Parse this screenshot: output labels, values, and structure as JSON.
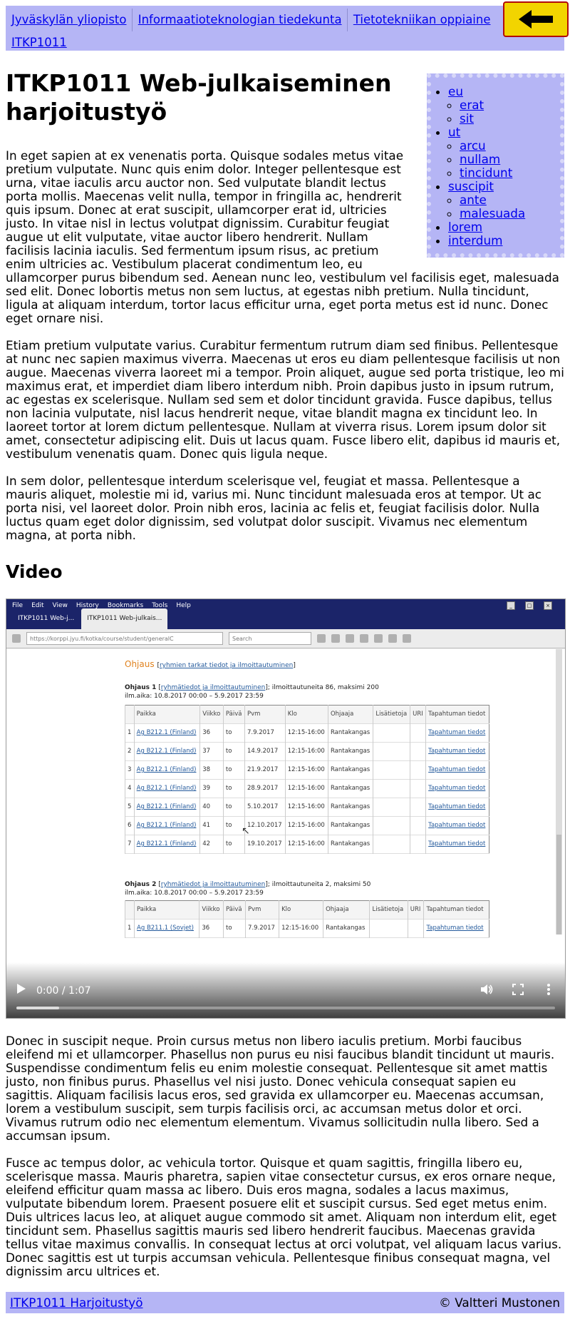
{
  "breadcrumb": [
    {
      "label": "Jyväskylän yliopisto"
    },
    {
      "label": "Informaatioteknologian tiedekunta"
    },
    {
      "label": "Tietotekniikan oppiaine"
    },
    {
      "label": "ITKP1011"
    }
  ],
  "back_button": {
    "icon": "left-arrow-icon",
    "color": "#f2d400"
  },
  "sidenav": [
    {
      "label": "eu",
      "children": [
        {
          "label": "erat"
        },
        {
          "label": "sit"
        }
      ]
    },
    {
      "label": "ut",
      "children": [
        {
          "label": "arcu"
        },
        {
          "label": "nullam"
        },
        {
          "label": "tincidunt"
        }
      ]
    },
    {
      "label": "suscipit",
      "children": [
        {
          "label": "ante"
        },
        {
          "label": "malesuada"
        }
      ]
    },
    {
      "label": "lorem",
      "children": []
    },
    {
      "label": "interdum",
      "children": []
    }
  ],
  "page": {
    "title": "ITKP1011 Web-julkaiseminen harjoitustyö",
    "paragraphs_top": [
      "In eget sapien at ex venenatis porta. Quisque sodales metus vitae pretium vulputate. Nunc quis enim dolor. Integer pellentesque est urna, vitae iaculis arcu auctor non. Sed vulputate blandit lectus porta mollis. Maecenas velit nulla, tempor in fringilla ac, hendrerit quis ipsum. Donec at erat suscipit, ullamcorper erat id, ultricies justo. In vitae nisl in lectus volutpat dignissim. Curabitur feugiat augue ut elit vulputate, vitae auctor libero hendrerit. Nullam facilisis lacinia iaculis. Sed fermentum ipsum risus, ac pretium enim ultricies ac. Vestibulum placerat condimentum leo, eu ullamcorper purus bibendum sed. Aenean nunc leo, vestibulum vel facilisis eget, malesuada sed elit. Donec lobortis metus non sem luctus, at egestas nibh pretium. Nulla tincidunt, ligula at aliquam interdum, tortor lacus efficitur urna, eget porta metus est id nunc. Donec eget ornare nisi.",
      "Etiam pretium vulputate varius. Curabitur fermentum rutrum diam sed finibus. Pellentesque at nunc nec sapien maximus viverra. Maecenas ut eros eu diam pellentesque facilisis ut non augue. Maecenas viverra laoreet mi a tempor. Proin aliquet, augue sed porta tristique, leo mi maximus erat, et imperdiet diam libero interdum nibh. Proin dapibus justo in ipsum rutrum, ac egestas ex scelerisque. Nullam sed sem et dolor tincidunt gravida. Fusce dapibus, tellus non lacinia vulputate, nisl lacus hendrerit neque, vitae blandit magna ex tincidunt leo. In laoreet tortor at lorem dictum pellentesque. Nullam at viverra risus. Lorem ipsum dolor sit amet, consectetur adipiscing elit. Duis ut lacus quam. Fusce libero elit, dapibus id mauris et, vestibulum venenatis quam. Donec quis ligula neque.",
      "In sem dolor, pellentesque interdum scelerisque vel, feugiat et massa. Pellentesque a mauris aliquet, molestie mi id, varius mi. Nunc tincidunt malesuada eros at tempor. Ut ac porta nisi, vel laoreet dolor. Proin nibh eros, lacinia ac felis et, feugiat facilisis dolor. Nulla luctus quam eget dolor dignissim, sed volutpat dolor suscipit. Vivamus nec elementum magna, at porta nibh."
    ],
    "video_heading": "Video",
    "paragraphs_bottom": [
      "Donec in suscipit neque. Proin cursus metus non libero iaculis pretium. Morbi faucibus eleifend mi et ullamcorper. Phasellus non purus eu nisi faucibus blandit tincidunt ut mauris. Suspendisse condimentum felis eu enim molestie consequat. Pellentesque sit amet mattis justo, non finibus purus. Phasellus vel nisi justo. Donec vehicula consequat sapien eu sagittis. Aliquam facilisis lacus eros, sed gravida ex ullamcorper eu. Maecenas accumsan, lorem a vestibulum suscipit, sem turpis facilisis orci, ac accumsan metus dolor et orci. Vivamus rutrum odio nec elementum elementum. Vivamus sollicitudin nulla libero. Sed a accumsan ipsum.",
      "Fusce ac tempus dolor, ac vehicula tortor. Quisque et quam sagittis, fringilla libero eu, scelerisque massa. Mauris pharetra, sapien vitae consectetur cursus, ex eros ornare neque, eleifend efficitur quam massa ac libero. Duis eros magna, sodales a lacus maximus, vulputate bibendum lorem. Praesent posuere elit et suscipit cursus. Sed eget metus enim. Duis ultrices lacus leo, at aliquet augue commodo sit amet. Aliquam non interdum elit, eget tincidunt sem. Phasellus sagittis mauris sed libero hendrerit faucibus. Maecenas gravida tellus vitae maximus convallis. In consequat lectus at orci volutpat, vel aliquam lacus varius. Donec sagittis est ut turpis accumsan vehicula. Pellentesque finibus consequat magna, vel dignissim arcu ultrices et."
    ]
  },
  "video": {
    "time": "0:00 / 1:07",
    "progress_fraction": 0.08,
    "browser": {
      "menu": [
        "File",
        "Edit",
        "View",
        "History",
        "Bookmarks",
        "Tools",
        "Help"
      ],
      "tabs": [
        "ITKP1011 Web-j...",
        "ITKP1011 Web-julkais..."
      ],
      "url": "https://korppi.jyu.fi/kotka/course/student/generalC",
      "search_placeholder": "Search"
    },
    "korppi": {
      "title": "Ohjaus",
      "title_link": "ryhmien tarkat tiedot ja ilmoittautuminen",
      "group1": {
        "name": "Ohjaus 1",
        "link": "ryhmätiedot ja ilmoittautuminen",
        "info": "; ilmoittautuneita 86, maksimi 200",
        "period": "ilm.aika: 10.8.2017 00:00 – 5.9.2017 23:59"
      },
      "group2": {
        "name": "Ohjaus 2",
        "link": "ryhmätiedot ja ilmoittautuminen",
        "info": "; ilmoittautuneita 2, maksimi 50",
        "period": "ilm.aika: 10.8.2017 00:00 – 5.9.2017 23:59"
      },
      "columns": [
        "",
        "Paikka",
        "Viikko",
        "Päivä",
        "Pvm",
        "Klo",
        "Ohjaaja",
        "Lisätietoja",
        "URI",
        "Tapahtuman tiedot"
      ],
      "rows": [
        [
          "1",
          "Ag B212.1 (Finland)",
          "36",
          "to",
          "7.9.2017",
          "12:15-16:00",
          "Rantakangas",
          "",
          "",
          "Tapahtuman tiedot"
        ],
        [
          "2",
          "Ag B212.1 (Finland)",
          "37",
          "to",
          "14.9.2017",
          "12:15-16:00",
          "Rantakangas",
          "",
          "",
          "Tapahtuman tiedot"
        ],
        [
          "3",
          "Ag B212.1 (Finland)",
          "38",
          "to",
          "21.9.2017",
          "12:15-16:00",
          "Rantakangas",
          "",
          "",
          "Tapahtuman tiedot"
        ],
        [
          "4",
          "Ag B212.1 (Finland)",
          "39",
          "to",
          "28.9.2017",
          "12:15-16:00",
          "Rantakangas",
          "",
          "",
          "Tapahtuman tiedot"
        ],
        [
          "5",
          "Ag B212.1 (Finland)",
          "40",
          "to",
          "5.10.2017",
          "12:15-16:00",
          "Rantakangas",
          "",
          "",
          "Tapahtuman tiedot"
        ],
        [
          "6",
          "Ag B212.1 (Finland)",
          "41",
          "to",
          "12.10.2017",
          "12:15-16:00",
          "Rantakangas",
          "",
          "",
          "Tapahtuman tiedot"
        ],
        [
          "7",
          "Ag B212.1 (Finland)",
          "42",
          "to",
          "19.10.2017",
          "12:15-16:00",
          "Rantakangas",
          "",
          "",
          "Tapahtuman tiedot"
        ]
      ],
      "rows2": [
        [
          "1",
          "Ag B211.1 (Sovjet)",
          "36",
          "to",
          "7.9.2017",
          "12:15-16:00",
          "Rantakangas",
          "",
          "",
          "Tapahtuman tiedot"
        ]
      ]
    }
  },
  "footer": {
    "left_link": "ITKP1011 Harjoitustyö",
    "right_text": "© Valtteri Mustonen"
  }
}
